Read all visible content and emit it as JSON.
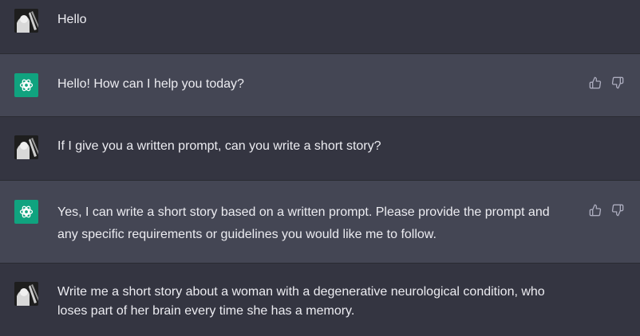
{
  "conversation": {
    "messages": [
      {
        "role": "user",
        "text": "Hello"
      },
      {
        "role": "assistant",
        "text": "Hello! How can I help you today?"
      },
      {
        "role": "user",
        "text": "If I give you a written prompt, can you write a short story?"
      },
      {
        "role": "assistant",
        "text": "Yes, I can write a short story based on a written prompt. Please provide the prompt and any specific requirements or guidelines you would like me to follow."
      },
      {
        "role": "user",
        "text": "Write me a short story about a woman with a degenerative neurological condition, who loses part of her brain every time she has a memory."
      }
    ]
  },
  "icons": {
    "assistant_avatar": "openai-logo-icon",
    "user_avatar": "user-photo-avatar",
    "thumbs_up": "thumbs-up-icon",
    "thumbs_down": "thumbs-down-icon"
  },
  "colors": {
    "background_user": "#343541",
    "background_assistant": "#444654",
    "assistant_avatar_bg": "#10a37f",
    "text": "#ececf1",
    "icon": "#acacbe"
  }
}
